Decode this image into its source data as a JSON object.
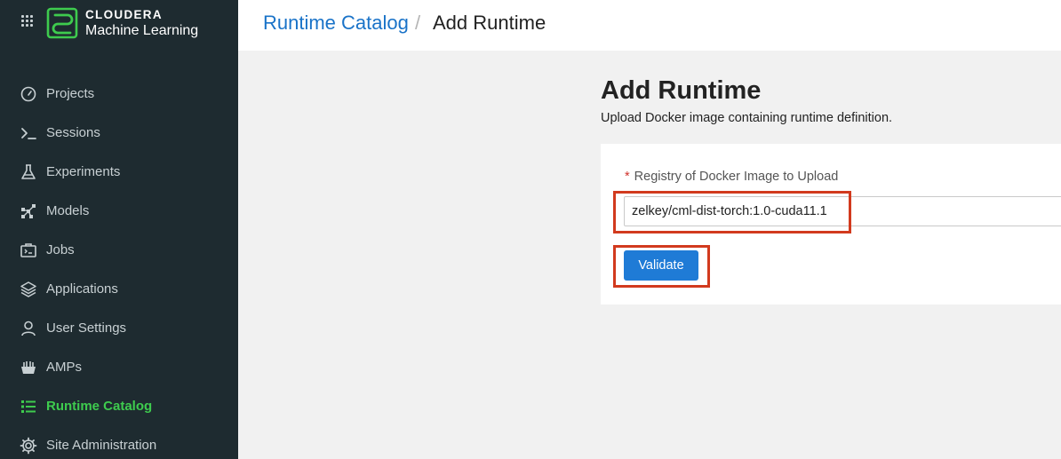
{
  "brand": {
    "name_top": "CLOUDERA",
    "name_bottom": "Machine Learning",
    "accent_color": "#3ecb4e"
  },
  "sidebar": {
    "items": [
      {
        "label": "Projects",
        "icon": "dashboard-gauge-icon",
        "active": false
      },
      {
        "label": "Sessions",
        "icon": "terminal-prompt-icon",
        "active": false
      },
      {
        "label": "Experiments",
        "icon": "flask-icon",
        "active": false
      },
      {
        "label": "Models",
        "icon": "model-nodes-icon",
        "active": false
      },
      {
        "label": "Jobs",
        "icon": "jobs-briefcase-icon",
        "active": false
      },
      {
        "label": "Applications",
        "icon": "layers-icon",
        "active": false
      },
      {
        "label": "User Settings",
        "icon": "user-icon",
        "active": false
      },
      {
        "label": "AMPs",
        "icon": "amps-basket-icon",
        "active": false
      },
      {
        "label": "Runtime Catalog",
        "icon": "list-icon",
        "active": true
      },
      {
        "label": "Site Administration",
        "icon": "gear-icon",
        "active": false
      }
    ]
  },
  "header": {
    "breadcrumb_link": "Runtime Catalog",
    "breadcrumb_separator": "/",
    "breadcrumb_current": "Add Runtime"
  },
  "main": {
    "title": "Add Runtime",
    "subtitle": "Upload Docker image containing runtime definition.",
    "form": {
      "required_marker": "*",
      "field_label": "Registry of Docker Image to Upload",
      "field_value": "zelkey/cml-dist-torch:1.0-cuda11.1",
      "validate_label": "Validate"
    }
  },
  "colors": {
    "sidebar_bg": "#1e2b30",
    "link_blue": "#1a73c8",
    "button_blue": "#1f7bd6",
    "highlight_red": "#d23a1e"
  }
}
